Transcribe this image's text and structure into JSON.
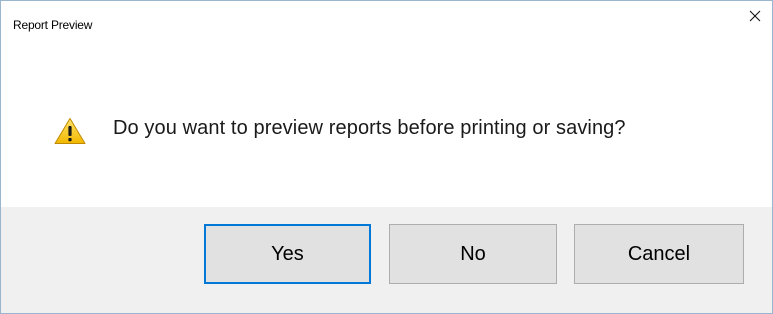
{
  "window": {
    "title": "Report Preview",
    "close_glyph": "×"
  },
  "message": {
    "icon": "warning-icon",
    "text": "Do you want to preview reports before printing or saving?"
  },
  "buttons": {
    "yes_label": "Yes",
    "no_label": "No",
    "cancel_label": "Cancel"
  },
  "colors": {
    "warning_fill": "#f5c400",
    "focus_border": "#0078d7",
    "button_face": "#e1e1e1",
    "footer_bg": "#f0f0f0"
  }
}
